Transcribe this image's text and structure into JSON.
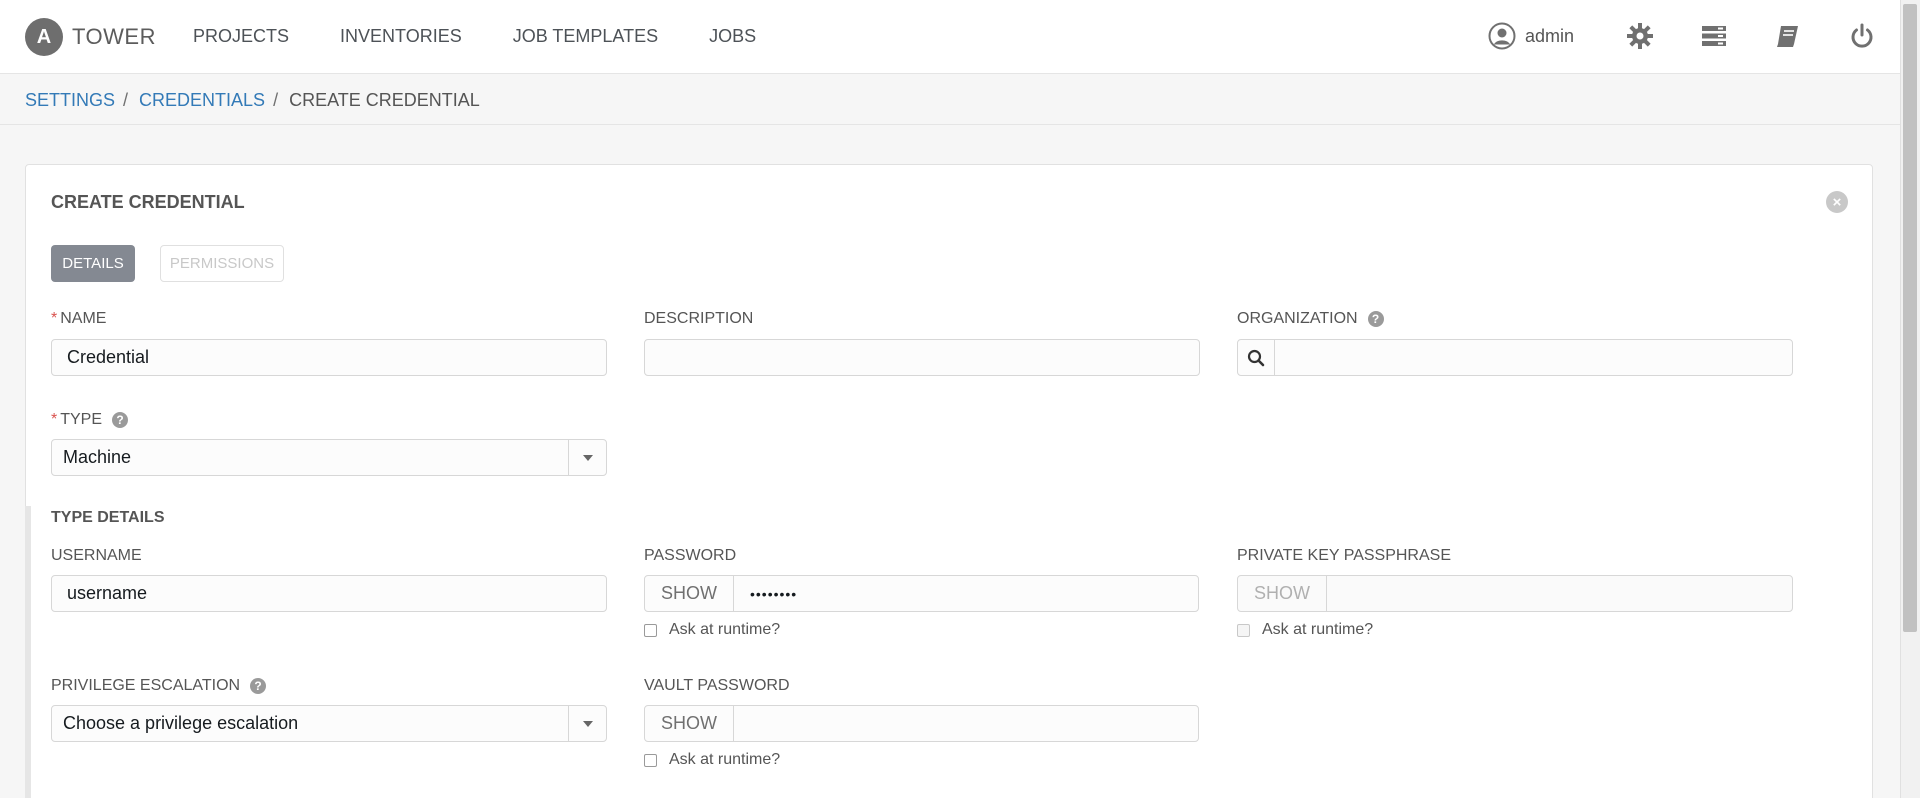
{
  "header": {
    "brand_logo": "A",
    "brand_name": "TOWER",
    "nav": [
      "PROJECTS",
      "INVENTORIES",
      "JOB TEMPLATES",
      "JOBS"
    ],
    "user": "admin",
    "icons": [
      "user-icon",
      "gear-icon",
      "server-stack-icon",
      "book-icon",
      "power-icon"
    ]
  },
  "breadcrumb": {
    "items": [
      "SETTINGS",
      "CREDENTIALS"
    ],
    "separator": "/",
    "current": "CREATE CREDENTIAL"
  },
  "form": {
    "title": "CREATE CREDENTIAL",
    "close": "×",
    "tabs": {
      "details": "DETAILS",
      "permissions": "PERMISSIONS"
    },
    "help_glyph": "?",
    "required_mark": "*",
    "name": {
      "label": "NAME",
      "value": "Credential"
    },
    "description": {
      "label": "DESCRIPTION",
      "value": ""
    },
    "organization": {
      "label": "ORGANIZATION",
      "value": ""
    },
    "type": {
      "label": "TYPE",
      "value": "Machine"
    },
    "type_details": {
      "title": "TYPE DETAILS",
      "username": {
        "label": "USERNAME",
        "value": "username"
      },
      "password": {
        "label": "PASSWORD",
        "show": "SHOW",
        "value": "••••••••",
        "ask": "Ask at runtime?"
      },
      "private_key_passphrase": {
        "label": "PRIVATE KEY PASSPHRASE",
        "show": "SHOW",
        "value": "",
        "ask": "Ask at runtime?"
      },
      "privilege_escalation": {
        "label": "PRIVILEGE ESCALATION",
        "value": "Choose a privilege escalation"
      },
      "vault_password": {
        "label": "VAULT PASSWORD",
        "show": "SHOW",
        "value": "",
        "ask": "Ask at runtime?"
      }
    }
  },
  "colors": {
    "link": "#337ab7",
    "required": "#d9534f",
    "active_tab": "#848992"
  }
}
